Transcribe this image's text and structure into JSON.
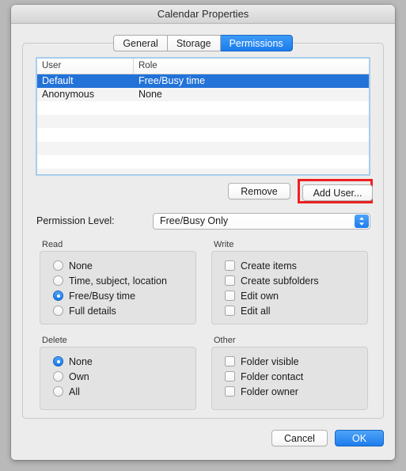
{
  "window": {
    "title": "Calendar Properties"
  },
  "tabs": [
    {
      "label": "General",
      "active": false
    },
    {
      "label": "Storage",
      "active": false
    },
    {
      "label": "Permissions",
      "active": true
    }
  ],
  "permissions_table": {
    "columns": [
      "User",
      "Role"
    ],
    "rows": [
      {
        "user": "Default",
        "role": "Free/Busy time",
        "selected": true
      },
      {
        "user": "Anonymous",
        "role": "None",
        "selected": false
      }
    ],
    "empty_row_count": 7
  },
  "table_buttons": {
    "remove_label": "Remove",
    "add_user_label": "Add User...",
    "add_user_highlighted": true,
    "highlight_color": "#ee2020"
  },
  "permission_level": {
    "label": "Permission Level:",
    "value": "Free/Busy Only"
  },
  "groups": {
    "read": {
      "label": "Read",
      "type": "radio",
      "options": [
        {
          "label": "None",
          "checked": false
        },
        {
          "label": "Time, subject, location",
          "checked": false
        },
        {
          "label": "Free/Busy time",
          "checked": true
        },
        {
          "label": "Full details",
          "checked": false
        }
      ]
    },
    "write": {
      "label": "Write",
      "type": "checkbox",
      "options": [
        {
          "label": "Create items",
          "checked": false
        },
        {
          "label": "Create subfolders",
          "checked": false
        },
        {
          "label": "Edit own",
          "checked": false
        },
        {
          "label": "Edit all",
          "checked": false
        }
      ]
    },
    "delete": {
      "label": "Delete",
      "type": "radio",
      "options": [
        {
          "label": "None",
          "checked": true
        },
        {
          "label": "Own",
          "checked": false
        },
        {
          "label": "All",
          "checked": false
        }
      ]
    },
    "other": {
      "label": "Other",
      "type": "checkbox",
      "options": [
        {
          "label": "Folder visible",
          "checked": false
        },
        {
          "label": "Folder contact",
          "checked": false
        },
        {
          "label": "Folder owner",
          "checked": false
        }
      ]
    }
  },
  "footer": {
    "cancel_label": "Cancel",
    "ok_label": "OK"
  },
  "colors": {
    "accent_blue": "#1d7ced",
    "selection_blue": "#2272d8",
    "annotation_red": "#ee2020"
  }
}
